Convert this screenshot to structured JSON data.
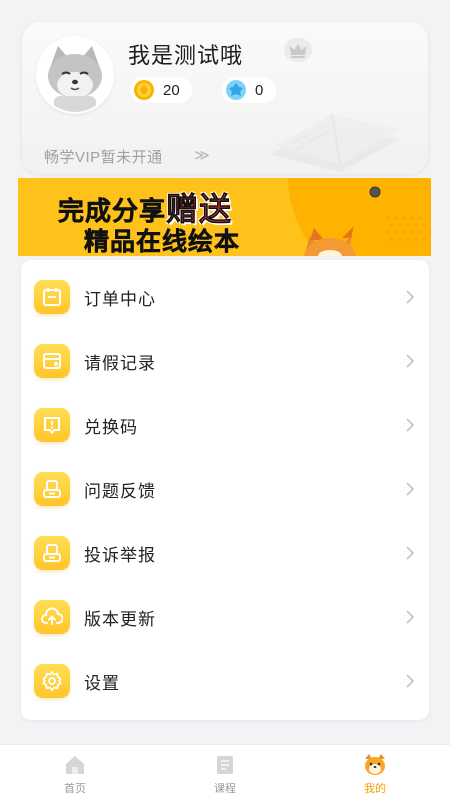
{
  "profile": {
    "username": "我是测试哦",
    "coins": "20",
    "gems": "0",
    "vip_text": "畅学VIP暂未开通",
    "vip_chevron": "≫"
  },
  "banner": {
    "line1_prefix": "完成分享",
    "line1_highlight": "赠送",
    "line2": "精品在线绘本"
  },
  "menu": {
    "items": [
      {
        "label": "订单中心",
        "icon": "order-icon"
      },
      {
        "label": "请假记录",
        "icon": "leave-record-icon"
      },
      {
        "label": "兑换码",
        "icon": "redeem-code-icon"
      },
      {
        "label": "问题反馈",
        "icon": "feedback-icon"
      },
      {
        "label": "投诉举报",
        "icon": "complaint-icon"
      },
      {
        "label": "版本更新",
        "icon": "update-icon"
      },
      {
        "label": "设置",
        "icon": "settings-icon"
      }
    ]
  },
  "tabbar": {
    "tabs": [
      {
        "label": "首页",
        "icon": "home-icon"
      },
      {
        "label": "课程",
        "icon": "course-icon"
      },
      {
        "label": "我的",
        "icon": "fox-profile-icon"
      }
    ],
    "active_index": 2
  },
  "colors": {
    "accent": "#ffc21a",
    "accent_text": "#f5a000",
    "highlight_red": "#e8302c"
  }
}
